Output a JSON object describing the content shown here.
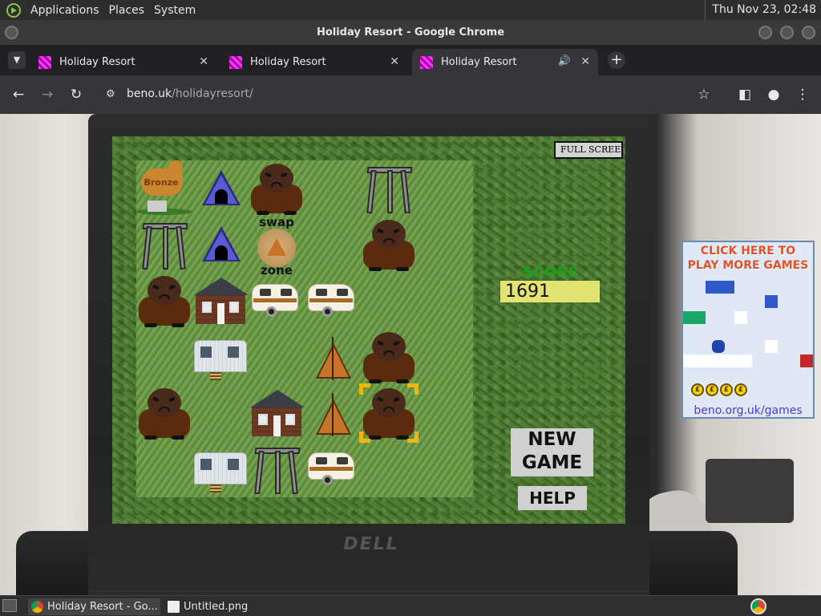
{
  "desktop": {
    "menus": [
      "Applications",
      "Places",
      "System"
    ],
    "clock": "Thu Nov 23, 02:48"
  },
  "window": {
    "title": "Holiday Resort - Google Chrome"
  },
  "tabs": [
    {
      "label": "Holiday Resort",
      "active": false
    },
    {
      "label": "Holiday Resort",
      "active": false
    },
    {
      "label": "Holiday Resort",
      "active": true,
      "audio": true
    }
  ],
  "toolbar": {
    "url_host": "beno.uk",
    "url_path": "/holidayresort/"
  },
  "game": {
    "full_screen_label": "FULL SCREEN",
    "score_label": "SCORE",
    "score_value": "1691",
    "new_game_line1": "NEW",
    "new_game_line2": "GAME",
    "help_label": "HELP",
    "swap_label": "swap",
    "zone_label": "zone",
    "bronze_label": "Bronze",
    "board": [
      [
        "bronze",
        "tent-blue",
        "bear",
        "empty",
        "tripod"
      ],
      [
        "tripod",
        "tent-blue",
        "swap-zone",
        "empty",
        "bear"
      ],
      [
        "bear",
        "house",
        "caravan",
        "caravan",
        "empty"
      ],
      [
        "empty",
        "mobile-home",
        "empty",
        "tent-orange",
        "bear"
      ],
      [
        "bear",
        "empty",
        "house",
        "tent-orange",
        "bear"
      ],
      [
        "empty",
        "mobile-home",
        "tripod",
        "caravan",
        "empty"
      ]
    ],
    "selected_cell": {
      "row": 4,
      "col": 4
    }
  },
  "ad": {
    "heading_line1": "CLICK HERE TO",
    "heading_line2": "PLAY MORE GAMES",
    "link": "beno.org.uk/games",
    "coin_symbol": "£"
  },
  "taskbar": {
    "items": [
      {
        "label": "Holiday Resort - Go...",
        "active": true
      },
      {
        "label": "Untitled.png",
        "active": false
      }
    ]
  }
}
